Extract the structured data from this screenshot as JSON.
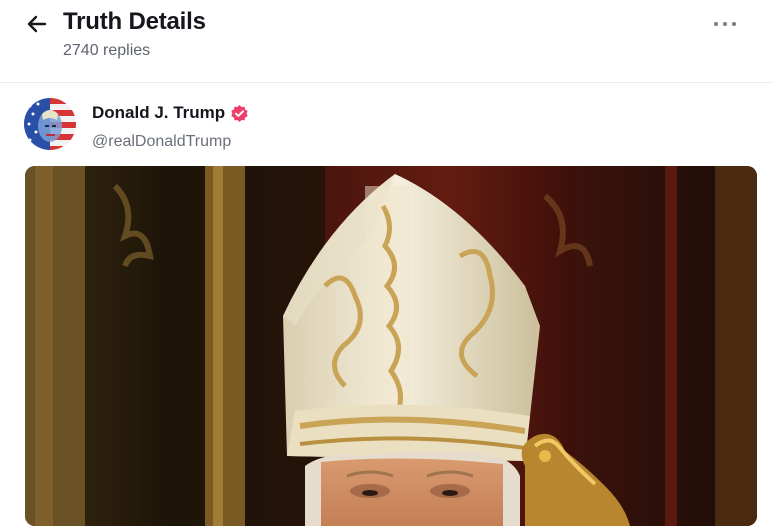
{
  "header": {
    "title": "Truth Details",
    "replies": "2740 replies"
  },
  "post": {
    "author_name": "Donald J. Trump",
    "author_handle": "@realDonaldTrump",
    "verified": true
  },
  "icons": {
    "back": "arrow-left-icon",
    "more": "more-horizontal-icon",
    "verified": "verified-badge-icon"
  },
  "colors": {
    "verified_badge": "#ee3f6b",
    "text_primary": "#16161d",
    "text_secondary": "#6b6f7b"
  }
}
